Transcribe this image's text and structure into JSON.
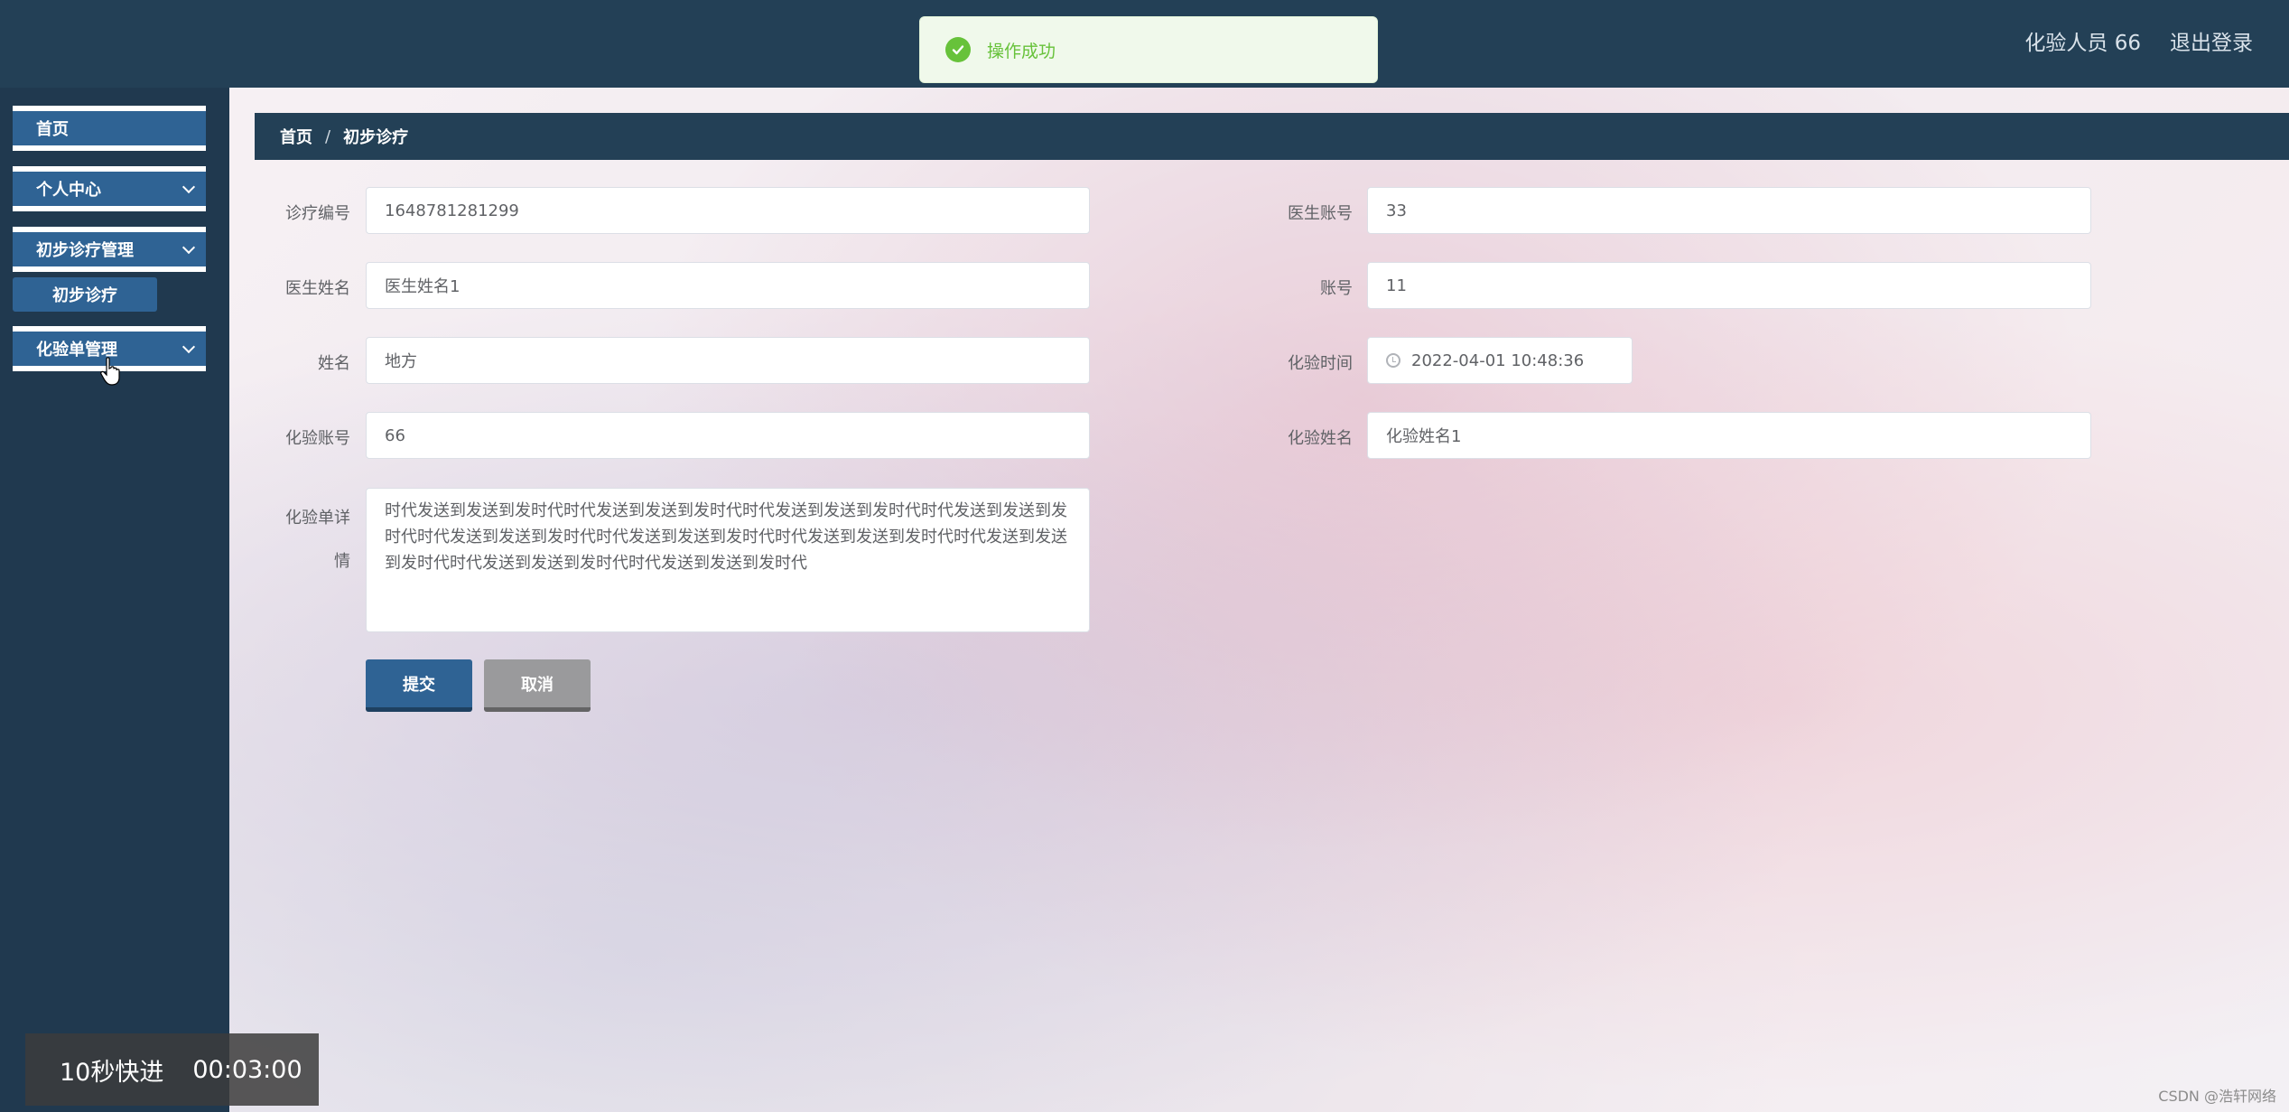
{
  "toast": {
    "message": "操作成功",
    "icon": "check-circle-icon",
    "color": "#67c23a"
  },
  "header": {
    "user": "化验人员 66",
    "logout": "退出登录"
  },
  "sidebar": {
    "items": [
      {
        "label": "首页"
      },
      {
        "label": "个人中心"
      },
      {
        "label": "初步诊疗管理"
      },
      {
        "label": "化验单管理"
      }
    ],
    "submenu": {
      "label": "初步诊疗"
    }
  },
  "breadcrumb": {
    "home": "首页",
    "separator": "/",
    "current": "初步诊疗"
  },
  "form": {
    "diagnosis_no": {
      "label": "诊疗编号",
      "value": "1648781281299"
    },
    "doctor_account": {
      "label": "医生账号",
      "value": "33"
    },
    "doctor_name": {
      "label": "医生姓名",
      "value": "医生姓名1"
    },
    "account": {
      "label": "账号",
      "value": "11"
    },
    "name": {
      "label": "姓名",
      "value": "地方"
    },
    "test_time": {
      "label": "化验时间",
      "value": "2022-04-01 10:48:36"
    },
    "test_account": {
      "label": "化验账号",
      "value": "66"
    },
    "test_name": {
      "label": "化验姓名",
      "value": "化验姓名1"
    },
    "test_detail": {
      "label_line1": "化验单详",
      "label_line2": "情",
      "value": "时代发送到发送到发时代时代发送到发送到发时代时代发送到发送到发时代时代发送到发送到发时代时代发送到发送到发时代时代发送到发送到发时代时代发送到发送到发时代时代发送到发送到发时代时代发送到发送到发时代时代发送到发送到发时代"
    },
    "submit": "提交",
    "cancel": "取消"
  },
  "video_overlay": {
    "label": "10秒快进",
    "time": "00:03:00"
  },
  "watermark": "CSDN @浩轩网络",
  "colors": {
    "sidebar_bg": "#20394f",
    "accent": "#2f6394",
    "header_bg": "#234056"
  }
}
